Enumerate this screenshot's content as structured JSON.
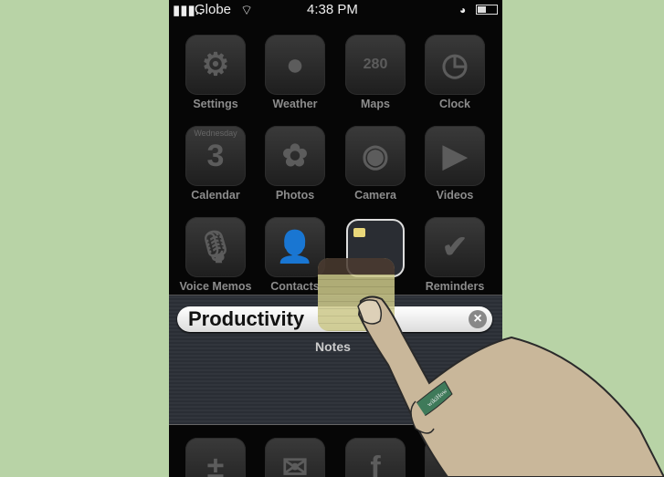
{
  "status": {
    "carrier": "Globe",
    "time": "4:38 PM"
  },
  "apps": [
    {
      "label": "Settings",
      "icon": "gear-icon",
      "glyph": "⚙"
    },
    {
      "label": "Weather",
      "icon": "weather-icon",
      "glyph": "●"
    },
    {
      "label": "Maps",
      "icon": "map-icon",
      "glyph": "280"
    },
    {
      "label": "Clock",
      "icon": "clock-icon",
      "glyph": "◷"
    },
    {
      "label": "Calendar",
      "icon": "calendar-icon",
      "glyph": "3"
    },
    {
      "label": "Photos",
      "icon": "flower-icon",
      "glyph": "✿"
    },
    {
      "label": "Camera",
      "icon": "camera-icon",
      "glyph": "◉"
    },
    {
      "label": "Videos",
      "icon": "clapperboard-icon",
      "glyph": "▶"
    },
    {
      "label": "Voice Memos",
      "icon": "microphone-icon",
      "glyph": "🎙"
    },
    {
      "label": "Contacts",
      "icon": "contact-icon",
      "glyph": "👤"
    },
    {
      "label": "",
      "icon": "folder-icon",
      "glyph": ""
    },
    {
      "label": "Reminders",
      "icon": "checklist-icon",
      "glyph": "✔"
    }
  ],
  "calendar_day": "Wednesday",
  "folder": {
    "name": "Productivity",
    "app_label": "Notes"
  },
  "dock": [
    {
      "icon": "calculator-icon",
      "glyph": "±"
    },
    {
      "icon": "mail-icon",
      "glyph": "✉"
    },
    {
      "icon": "facebook-icon",
      "glyph": "f"
    },
    {
      "icon": "app-icon",
      "glyph": ""
    }
  ],
  "ring_text": "wikiHow",
  "colors": {
    "background": "#b8d3a6",
    "skin": "#c9b79a",
    "ring": "#3f7a5a"
  }
}
